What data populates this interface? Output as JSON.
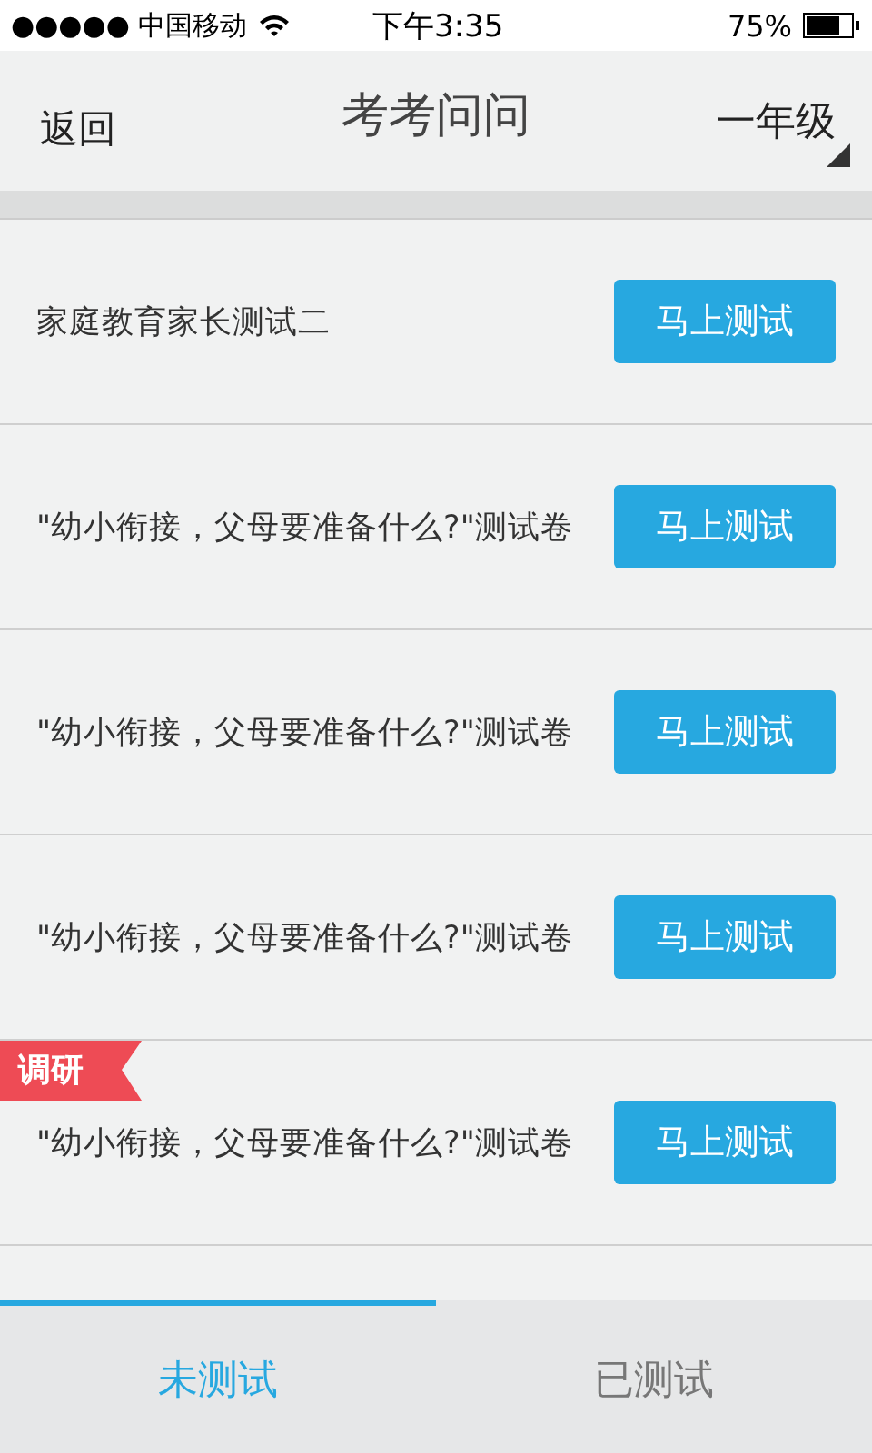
{
  "status_bar": {
    "carrier": "●●●●● 中国移动",
    "time": "下午3:35",
    "battery": "75%"
  },
  "nav": {
    "back": "返回",
    "title": "考考问问",
    "grade": "一年级"
  },
  "tests": [
    {
      "title": "家庭教育家长测试二",
      "button": "马上测试"
    },
    {
      "title": "\"幼小衔接，父母要准备什么?\"测试卷",
      "button": "马上测试"
    },
    {
      "title": "\"幼小衔接，父母要准备什么?\"测试卷",
      "button": "马上测试"
    },
    {
      "title": "\"幼小衔接，父母要准备什么?\"测试卷",
      "button": "马上测试"
    },
    {
      "title": "\"幼小衔接，父母要准备什么?\"测试卷",
      "button": "马上测试",
      "tag": "调研"
    }
  ],
  "tabs": [
    {
      "label": "未测试",
      "selected": true
    },
    {
      "label": "已测试",
      "selected": false
    }
  ]
}
